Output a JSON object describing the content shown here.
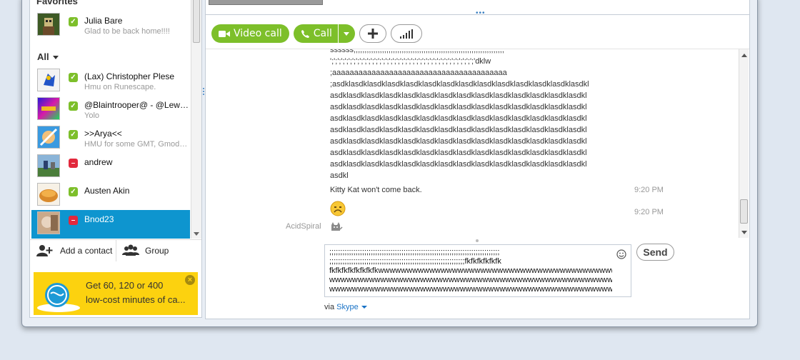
{
  "sidebar": {
    "favorites_title": "Favorites",
    "all_title": "All",
    "favorites": [
      {
        "name": "Julia Bare",
        "mood": "Glad to be back home!!!!",
        "status": "online"
      }
    ],
    "contacts": [
      {
        "name": "(Lax) Christopher Plese",
        "mood": "Hmu on Runescape.",
        "status": "online"
      },
      {
        "name": "@Blaintrooper@ - @Lewis B...",
        "mood": "Yolo",
        "status": "online"
      },
      {
        "name": ">>Arya<<",
        "mood": "HMU for some GMT, GmodZ...",
        "status": "online"
      },
      {
        "name": "andrew",
        "mood": "",
        "status": "busy"
      },
      {
        "name": "Austen Akin",
        "mood": "",
        "status": "online"
      },
      {
        "name": "Bnod23",
        "mood": "",
        "status": "busy"
      }
    ],
    "add_contact_label": "Add a contact",
    "group_label": "Group"
  },
  "promo": {
    "line1": "Get 60, 120 or 400",
    "line2": "low-cost minutes of ca..."
  },
  "toolbar": {
    "video_call_label": "Video call",
    "call_label": "Call"
  },
  "chat": {
    "message_block": "ssssss;;;;;;;;;;;;;;;;;;;;;;;;;;;;;;;;;;;;;;;;;;;;;;;;;;;;;;;;;;;;;;;;;;;;;\n';';';';';';';';';';';';';';';';';';';';';';';';';';';';';';';';';';';';';';';'dklw\n;aaaaaaaaaaaaaaaaaaaaaaaaaaaaaaaaaaaaaaaa\n;asdklasdklasdklasdklasdklasdklasdklasdklasdklasdklasdklasdklasdklasdkl\nasdklasdklasdklasdklasdklasdklasdklasdklasdklasdklasdklasdklasdklasdkl\nasdklasdklasdklasdklasdklasdklasdklasdklasdklasdklasdklasdklasdklasdkl\nasdklasdklasdklasdklasdklasdklasdklasdklasdklasdklasdklasdklasdklasdkl\nasdklasdklasdklasdklasdklasdklasdklasdklasdklasdklasdklasdklasdklasdkl\nasdklasdklasdklasdklasdklasdklasdklasdklasdklasdklasdklasdklasdklasdkl\nasdklasdklasdklasdklasdklasdklasdklasdklasdklasdklasdklasdklasdklasdkl\nasdklasdklasdklasdklasdklasdklasdklasdklasdklasdklasdklasdklasdklasdkl\nasdkl",
    "message_kitkat": "Kitty Kat won't come back.",
    "time_kitkat": "9:20 PM",
    "time_emoji": "9:20 PM",
    "sender_name": "AcidSpiral"
  },
  "compose": {
    "text": ";;;;;;;;;;;;;;;;;;;;;;;;;;;;;;;;;;;;;;;;;;;;;;;;;;;;;;;;;;;;;;;;;;;;;;;;;;;;;;\n;;;;;;;;;;;;;;;;;;;;;;;;;;;;;;;;;;;;;;;;;;;;;;;;;;;;;;;;;;;;;;fkfkfkfkfkfk\nfkfkfkfkfkfkfkfkwwwwwwwwwwwwwwwwwwwwwwwwwwwwwwwwwwwwwwwwwwwwww\nwwwwwwwwwwwwwwwwwwwwwwwwwwwwwwwwwwwwwwwwwwwwwwwwwwwwwwwwwwwwww\nwwwwwwwwwwwwwwwwwwwwwwwwwwwwwwwwwwwwwwwwwwwwwwwwwwwwwwasdkl",
    "send_label": "Send",
    "via_prefix": "via",
    "via_service": "Skype"
  },
  "colors": {
    "accent_green": "#7dbf2a",
    "selected_blue": "#0e95cf",
    "busy_red": "#e2283c",
    "promo_yellow": "#fcd20f"
  }
}
